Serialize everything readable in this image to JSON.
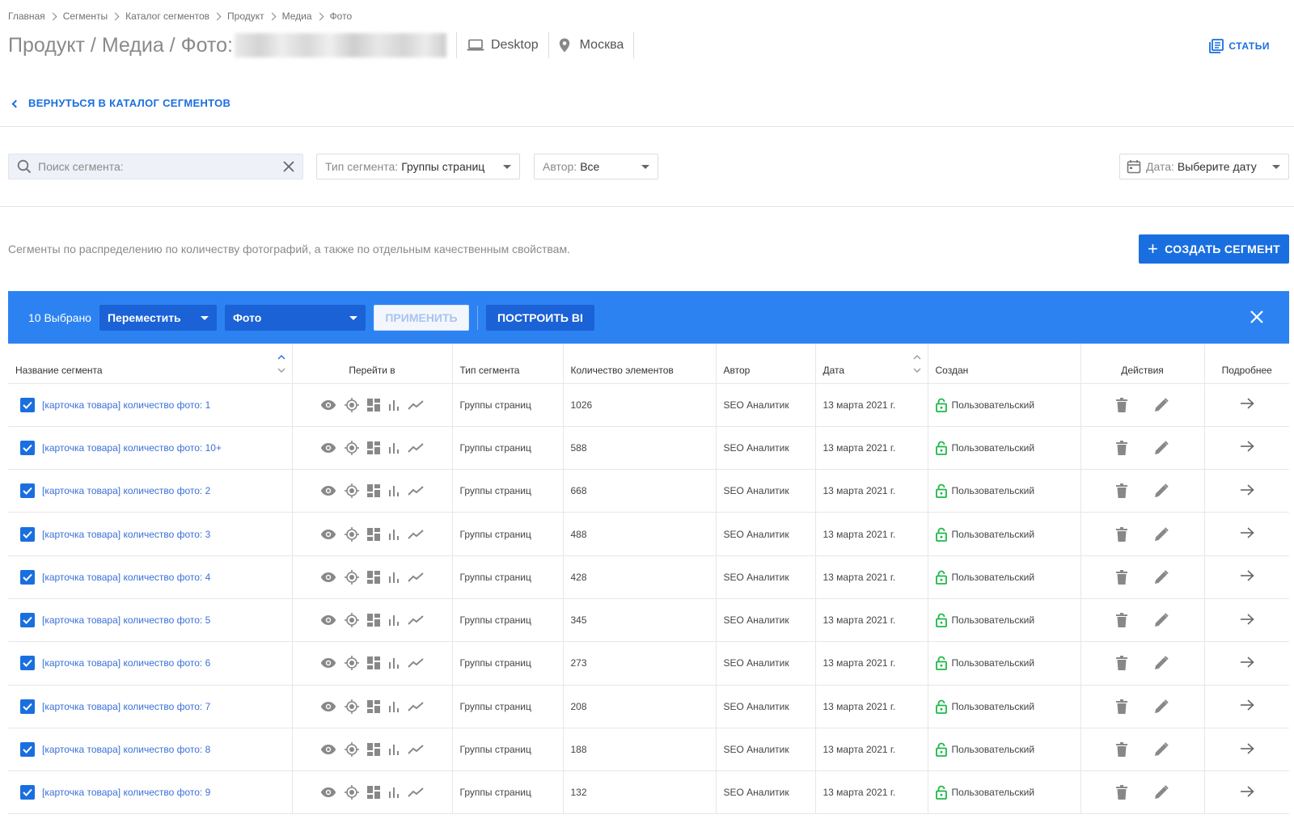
{
  "breadcrumb": [
    "Главная",
    "Сегменты",
    "Каталог сегментов",
    "Продукт",
    "Медиа",
    "Фото"
  ],
  "header": {
    "title": "Продукт / Медиа / Фото:",
    "device": "Desktop",
    "region": "Москва",
    "articles_label": "СТАТЬИ"
  },
  "back_link": "ВЕРНУТЬСЯ В КАТАЛОГ СЕГМЕНТОВ",
  "filters": {
    "search_placeholder": "Поиск сегмента:",
    "type_label": "Тип сегмента:",
    "type_value": "Группы страниц",
    "author_label": "Автор:",
    "author_value": "Все",
    "date_label": "Дата:",
    "date_value": "Выберите дату"
  },
  "description": "Сегменты по распределению по количеству фотографий, а также по отдельным качественным свойствам.",
  "create_button": "СОЗДАТЬ СЕГМЕНТ",
  "selection_bar": {
    "count_label": "10 Выбрано",
    "action_value": "Переместить",
    "folder_value": "Фото",
    "apply_label": "ПРИМЕНИТЬ",
    "bi_label": "ПОСТРОИТЬ BI"
  },
  "table": {
    "columns": [
      "Название сегмента",
      "Перейти в",
      "Тип сегмента",
      "Количество элементов",
      "Автор",
      "Дата",
      "Создан",
      "Действия",
      "Подробнее"
    ],
    "rows": [
      {
        "name": "[карточка товара] количество фото: 1",
        "type": "Группы страниц",
        "count": "1026",
        "author": "SEO Аналитик",
        "date": "13 марта 2021 г.",
        "created": "Пользовательский"
      },
      {
        "name": "[карточка товара] количество фото: 10+",
        "type": "Группы страниц",
        "count": "588",
        "author": "SEO Аналитик",
        "date": "13 марта 2021 г.",
        "created": "Пользовательский"
      },
      {
        "name": "[карточка товара] количество фото: 2",
        "type": "Группы страниц",
        "count": "668",
        "author": "SEO Аналитик",
        "date": "13 марта 2021 г.",
        "created": "Пользовательский"
      },
      {
        "name": "[карточка товара] количество фото: 3",
        "type": "Группы страниц",
        "count": "488",
        "author": "SEO Аналитик",
        "date": "13 марта 2021 г.",
        "created": "Пользовательский"
      },
      {
        "name": "[карточка товара] количество фото: 4",
        "type": "Группы страниц",
        "count": "428",
        "author": "SEO Аналитик",
        "date": "13 марта 2021 г.",
        "created": "Пользовательский"
      },
      {
        "name": "[карточка товара] количество фото: 5",
        "type": "Группы страниц",
        "count": "345",
        "author": "SEO Аналитик",
        "date": "13 марта 2021 г.",
        "created": "Пользовательский"
      },
      {
        "name": "[карточка товара] количество фото: 6",
        "type": "Группы страниц",
        "count": "273",
        "author": "SEO Аналитик",
        "date": "13 марта 2021 г.",
        "created": "Пользовательский"
      },
      {
        "name": "[карточка товара] количество фото: 7",
        "type": "Группы страниц",
        "count": "208",
        "author": "SEO Аналитик",
        "date": "13 марта 2021 г.",
        "created": "Пользовательский"
      },
      {
        "name": "[карточка товара] количество фото: 8",
        "type": "Группы страниц",
        "count": "188",
        "author": "SEO Аналитик",
        "date": "13 марта 2021 г.",
        "created": "Пользовательский"
      },
      {
        "name": "[карточка товара] количество фото: 9",
        "type": "Группы страниц",
        "count": "132",
        "author": "SEO Аналитик",
        "date": "13 марта 2021 г.",
        "created": "Пользовательский"
      }
    ]
  },
  "icons": {
    "goto": [
      "eye-icon",
      "target-icon",
      "dashboard-icon",
      "bar-chart-icon",
      "trend-icon"
    ],
    "actions": [
      "trash-icon",
      "pencil-icon"
    ],
    "details": "arrow-right-icon",
    "created": "unlock-icon"
  },
  "colors": {
    "accent": "#1a6fe0",
    "selection_bar": "#2d82f2",
    "lock_green": "#1fb84a",
    "icon_gray": "#8a8a8a"
  }
}
